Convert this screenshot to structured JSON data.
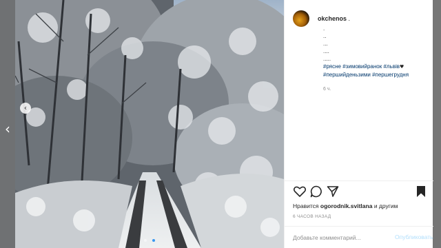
{
  "post": {
    "username": "okchenos",
    "username_suffix": " .",
    "caption_lines": [
      ".",
      "..",
      "...",
      "....",
      "....."
    ],
    "hashtags_line1": "#рясне #зимовийранок #львів",
    "hashtags_line2": "#першийденьзими #першегрудня",
    "caption_emoji": "♥",
    "time_ago": "6 ч.",
    "likes_prefix": "Нравится ",
    "likes_user": "ogorodnik.svitlana",
    "likes_suffix": " и другим",
    "posted_ago": "6 ЧАСОВ НАЗАД",
    "comment_placeholder": "Добавьте комментарий...",
    "publish_label": "Опубликовать"
  },
  "icons": {
    "prev_post": "chevron-left-icon",
    "photo_prev": "chevron-left-icon",
    "like": "heart-icon",
    "comment": "comment-icon",
    "share": "paper-plane-icon",
    "save": "bookmark-icon"
  },
  "colors": {
    "link_blue": "#00376b",
    "muted": "#8e8e8e",
    "publish_disabled": "#b2dffc",
    "text": "#262626"
  }
}
